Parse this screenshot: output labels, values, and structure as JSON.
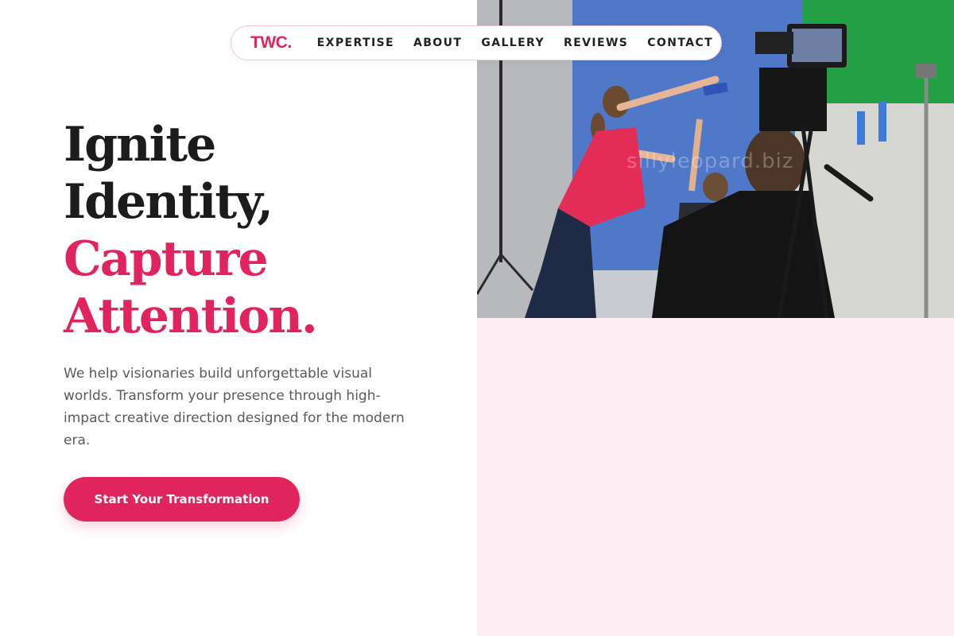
{
  "brand": {
    "logo": "TWC.",
    "accent_color": "#e0245e"
  },
  "nav": {
    "items": [
      {
        "label": "EXPERTISE"
      },
      {
        "label": "ABOUT"
      },
      {
        "label": "GALLERY"
      },
      {
        "label": "REVIEWS"
      },
      {
        "label": "CONTACT"
      }
    ]
  },
  "hero": {
    "headline_line1": "Ignite",
    "headline_line2": "Identity,",
    "headline_line3": "Capture",
    "headline_line4": "Attention.",
    "description": "We help visionaries build unforgettable visual worlds. Transform your presence through high-impact creative direction designed for the modern era.",
    "cta_label": "Start Your Transformation",
    "image_watermark": "sillyleopard.biz"
  },
  "colors": {
    "headline_dark": "#1c1c1c",
    "right_panel_bg": "#fdeef3"
  }
}
